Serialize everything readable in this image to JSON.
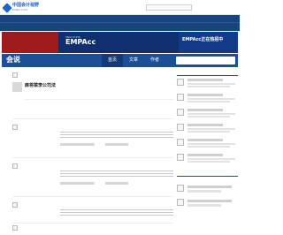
{
  "site": {
    "logo_text": "中国会计视野",
    "logo_sub": "ESNAI.COM"
  },
  "top_links": [
    "",
    "",
    "",
    "",
    "",
    ""
  ],
  "top_right": [
    "",
    "",
    ""
  ],
  "nav_row1": [
    "",
    "",
    "",
    "",
    "",
    "",
    "",
    "",
    "",
    "",
    "",
    "",
    "",
    "",
    "",
    ""
  ],
  "nav_row2": [
    "",
    "",
    "",
    "",
    "",
    "",
    "",
    "",
    "",
    "",
    "",
    "",
    "",
    ""
  ],
  "banner": {
    "left_text": "",
    "empa": "EMPAcc",
    "empa_sub": "SNAI-CUHK",
    "middle_text": "",
    "right_title": "EMPAcc正在热招中",
    "right_sub": ""
  },
  "subbar": {
    "title": "会说",
    "slogan": "",
    "tabs": [
      "首页",
      "文章",
      "作者"
    ],
    "search_placeholder": ""
  },
  "pinned": {
    "title": "麻将菜李公司法",
    "meta": [
      "",
      "",
      ""
    ],
    "categories": [
      "",
      "",
      "",
      "",
      "",
      "",
      "",
      ""
    ]
  },
  "posts": [
    {
      "title": ""
    },
    {
      "title": ""
    },
    {
      "title": ""
    },
    {
      "title": ""
    }
  ],
  "sidebar": {
    "recommended_title": "",
    "hot_title": "",
    "hot_tabs": [
      "",
      "",
      ""
    ]
  }
}
